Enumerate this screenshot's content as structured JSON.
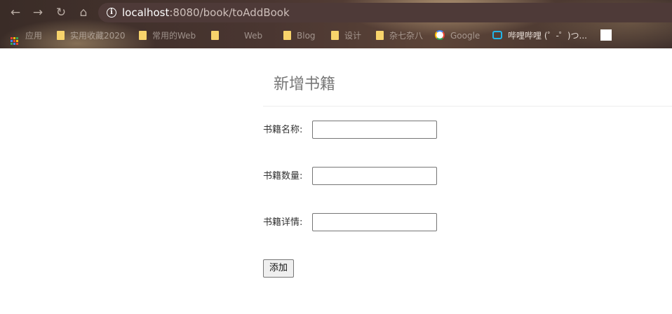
{
  "browser": {
    "url_host": "localhost",
    "url_path": ":8080/book/toAddBook",
    "nav": {
      "back": "←",
      "forward": "→",
      "reload": "↻",
      "home": "⌂"
    },
    "bookmarks": [
      {
        "label": "应用",
        "icon": "apps-grid-icon"
      },
      {
        "label": "实用收藏2020",
        "icon": "folder-icon"
      },
      {
        "label": "常用的Web",
        "icon": "folder-icon"
      },
      {
        "label": "Web",
        "icon": "folder-icon"
      },
      {
        "label": "Blog",
        "icon": "folder-icon"
      },
      {
        "label": "设计",
        "icon": "folder-icon"
      },
      {
        "label": "杂七杂八",
        "icon": "folder-icon"
      },
      {
        "label": "Google",
        "icon": "google-icon"
      },
      {
        "label": "哔哩哔哩 (゜-゜)つ...",
        "icon": "bilibili-icon"
      },
      {
        "label": "",
        "icon": "page-icon"
      }
    ]
  },
  "form": {
    "title": "新增书籍",
    "fields": [
      {
        "label": "书籍名称:",
        "value": "",
        "placeholder": ""
      },
      {
        "label": "书籍数量:",
        "value": "",
        "placeholder": ""
      },
      {
        "label": "书籍详情:",
        "value": "",
        "placeholder": ""
      }
    ],
    "submit_label": "添加"
  },
  "colors": {
    "chrome_dark": "#4a3631",
    "address_bar": "#4e3a38",
    "folder": "#f7d36b",
    "title_text": "#777777",
    "label_text": "#333333"
  }
}
